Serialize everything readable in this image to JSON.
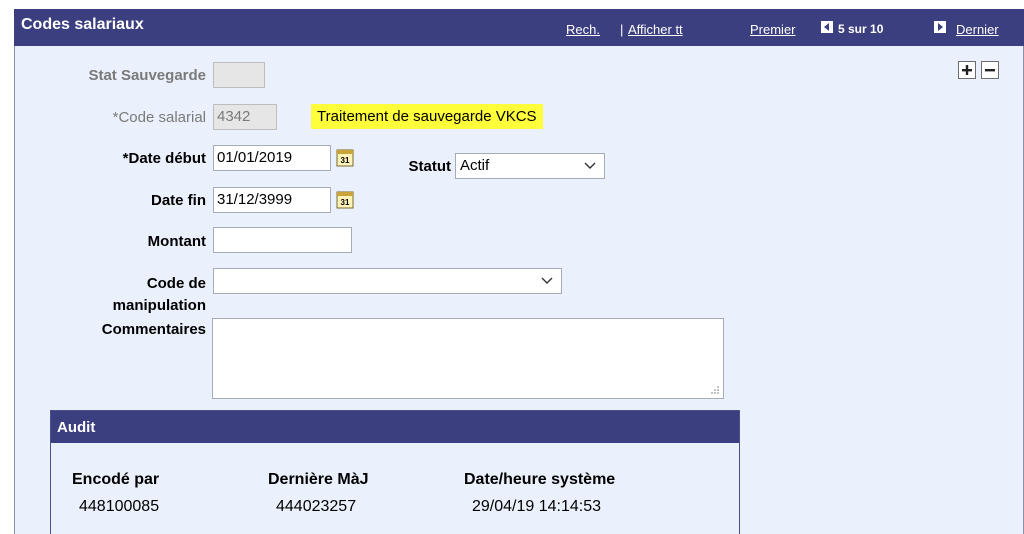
{
  "header": {
    "title": "Codes salariaux",
    "search_link": "Rech.",
    "separator": "|",
    "show_all_link": "Afficher tt",
    "first_link": "Premier",
    "count": "5 sur 10",
    "last_link": "Dernier"
  },
  "form": {
    "stat_sauvegarde": {
      "label": "Stat Sauvegarde",
      "value": ""
    },
    "code_salarial": {
      "label": "*Code salarial",
      "value": "4342",
      "description": "Traitement de sauvegarde VKCS"
    },
    "date_debut": {
      "label": "*Date début",
      "value": "01/01/2019"
    },
    "statut": {
      "label": "Statut",
      "value": "Actif"
    },
    "date_fin": {
      "label": "Date fin",
      "value": "31/12/3999"
    },
    "montant": {
      "label": "Montant",
      "value": ""
    },
    "code_manipulation": {
      "label_line1": "Code de",
      "label_line2": "manipulation",
      "value": ""
    },
    "commentaires": {
      "label": "Commentaires",
      "value": ""
    }
  },
  "audit": {
    "title": "Audit",
    "columns": [
      {
        "header": "Encodé par",
        "value": "448100085"
      },
      {
        "header": "Dernière MàJ",
        "value": "444023257"
      },
      {
        "header": "Date/heure système",
        "value": "29/04/19 14:14:53"
      }
    ]
  },
  "icons": {
    "calendar": "calendar-icon",
    "add_row": "plus-icon",
    "remove_row": "minus-icon",
    "prev": "triangle-left-icon",
    "next": "triangle-right-icon",
    "chevron": "chevron-down-icon"
  },
  "colors": {
    "header_bg": "#3b3e7f",
    "panel_bg": "#eaf1fc",
    "highlight": "#fffe3a"
  }
}
